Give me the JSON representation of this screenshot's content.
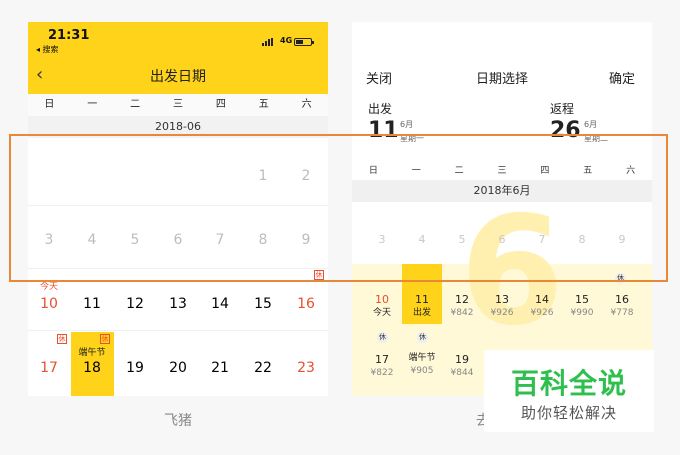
{
  "left": {
    "status_time": "21:31",
    "back_app": "◂ 搜索",
    "network": "4G",
    "title": "出发日期",
    "weekdays": [
      "日",
      "一",
      "二",
      "三",
      "四",
      "五",
      "六"
    ],
    "month": "2018-06",
    "row1": [
      "1",
      "2"
    ],
    "row2": [
      "3",
      "4",
      "5",
      "6",
      "7",
      "8",
      "9"
    ],
    "row3": [
      "10",
      "11",
      "12",
      "13",
      "14",
      "15",
      "16"
    ],
    "row4": [
      "17",
      "18",
      "19",
      "20",
      "21",
      "22",
      "23"
    ],
    "today_label": "今天",
    "holiday_badge": "休",
    "festival_label": "端午节",
    "caption": "飞猪",
    "accent_color": "#ffd31a",
    "weekend_color": "#e8502e"
  },
  "right": {
    "close": "关闭",
    "title": "日期选择",
    "confirm": "确定",
    "depart_label": "出发",
    "depart_day": "11",
    "depart_month": "6月",
    "depart_weekday": "星期一",
    "return_label": "返程",
    "return_day": "26",
    "return_month": "6月",
    "return_weekday": "星期二",
    "weekdays": [
      "日",
      "一",
      "二",
      "三",
      "四",
      "五",
      "六"
    ],
    "month": "2018年6月",
    "month_watermark": "6",
    "row_gray": [
      "3",
      "4",
      "5",
      "6",
      "7",
      "8",
      "9"
    ],
    "row2_days": [
      "10",
      "11",
      "12",
      "13",
      "14",
      "15",
      "16"
    ],
    "row2_sub": [
      "今天",
      "出发",
      "¥842",
      "¥926",
      "¥926",
      "¥990",
      "¥778"
    ],
    "row3_days": [
      "17",
      "18",
      "19"
    ],
    "row3_festival": "端午节",
    "row3_sub": [
      "¥822",
      "¥905",
      "¥844"
    ],
    "holiday_badge": "休",
    "caption": "去"
  },
  "watermark": {
    "title": "百科全说",
    "subtitle": "助你轻松解决"
  }
}
